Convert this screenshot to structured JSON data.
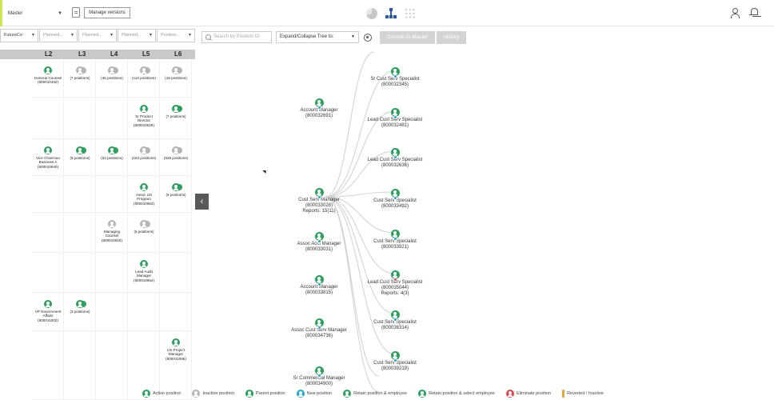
{
  "topbar": {
    "version_select": "Master",
    "manage_versions": "Manage versions"
  },
  "left_panel": {
    "filters": [
      "FutureCo",
      "Planned...",
      "Planned...",
      "Planned...",
      "Position..."
    ],
    "levels": [
      "L2",
      "L3",
      "L4",
      "L5",
      "L6"
    ],
    "cards": [
      {
        "col": 0,
        "row": 0,
        "type": "active",
        "lines": [
          "General Counsel",
          "(800010432)"
        ]
      },
      {
        "col": 1,
        "row": 0,
        "type": "inactive-multi",
        "lines": [
          "(7 positions)"
        ]
      },
      {
        "col": 2,
        "row": 0,
        "type": "inactive-multi",
        "lines": [
          "(45 positions)"
        ]
      },
      {
        "col": 3,
        "row": 0,
        "type": "inactive-multi",
        "lines": [
          "(112 positions)"
        ]
      },
      {
        "col": 4,
        "row": 0,
        "type": "inactive-multi",
        "lines": [
          "(18 positions)"
        ]
      },
      {
        "col": 3,
        "row": 1,
        "type": "active",
        "lines": [
          "Sr Product",
          "Director",
          "(800010626)"
        ]
      },
      {
        "col": 4,
        "row": 1,
        "type": "active-multi",
        "lines": [
          "(7 positions)"
        ]
      },
      {
        "col": 0,
        "row": 2,
        "type": "active",
        "lines": [
          "Vice Chairman",
          "Business A",
          "(800010640)"
        ]
      },
      {
        "col": 1,
        "row": 2,
        "type": "active-multi",
        "lines": [
          "(6 positions)"
        ]
      },
      {
        "col": 2,
        "row": 2,
        "type": "active-multi",
        "lines": [
          "(34 positions)"
        ]
      },
      {
        "col": 3,
        "row": 2,
        "type": "inactive-multi",
        "lines": [
          "(163 positions)"
        ]
      },
      {
        "col": 4,
        "row": 2,
        "type": "inactive-multi",
        "lines": [
          "(628 positions)"
        ]
      },
      {
        "col": 3,
        "row": 3,
        "type": "active",
        "lines": [
          "Assoc US",
          "Program",
          "(800010663)"
        ]
      },
      {
        "col": 4,
        "row": 3,
        "type": "active-multi",
        "lines": [
          "(6 positions)"
        ]
      },
      {
        "col": 2,
        "row": 4,
        "type": "inactive",
        "lines": [
          "Managing",
          "Counsel",
          "(800010915)"
        ]
      },
      {
        "col": 3,
        "row": 4,
        "type": "inactive-multi",
        "lines": [
          "(5 positions)"
        ]
      },
      {
        "col": 3,
        "row": 5,
        "type": "active",
        "lines": [
          "Lead Audit",
          "Manager",
          "(800010654)"
        ]
      },
      {
        "col": 0,
        "row": 6,
        "type": "active",
        "lines": [
          "VP Government",
          "Affairs",
          "(800011002)"
        ]
      },
      {
        "col": 1,
        "row": 6,
        "type": "active-multi",
        "lines": [
          "(3 positions)"
        ]
      },
      {
        "col": 4,
        "row": 7,
        "type": "active",
        "lines": [
          "US Project",
          "Manager",
          "(800011086)"
        ]
      }
    ]
  },
  "chart_toolbar": {
    "search_placeholder": "Search by Position ID",
    "expand_label": "Expand/Collapse Tree to:",
    "commit_label": "Commit to Master",
    "history_label": "History"
  },
  "tree": {
    "focus": {
      "title": "Cust Serv Manager",
      "id": "(800033028)",
      "reports": "Reports: 15(11)"
    },
    "left_nodes": [
      {
        "title": "Account Manager",
        "id": "(800032691)"
      },
      {
        "title": "Assoc Acct Manager",
        "id": "(800033031)"
      },
      {
        "title": "Account Manager",
        "id": "(800033815)"
      },
      {
        "title": "Assoc Cust Serv Manager",
        "id": "(800034736)"
      },
      {
        "title": "Sr Commercial Manager",
        "id": "(800034900)"
      }
    ],
    "right_nodes": [
      {
        "title": "Sr Cust Serv Specialist",
        "id": "(800032345)",
        "extra": "",
        "status": "new"
      },
      {
        "title": "Lead Cust Serv Specialist",
        "id": "(800032481)",
        "extra": "",
        "status": "new"
      },
      {
        "title": "Lead Cust Serv Specialist",
        "id": "(800032636)",
        "extra": "",
        "status": "new"
      },
      {
        "title": "Cust Serv Specialist",
        "id": "(800033492)",
        "extra": "",
        "status": "new"
      },
      {
        "title": "Cust Serv Specialist",
        "id": "(800033921)",
        "extra": "",
        "status": "new"
      },
      {
        "title": "Lead Cust Serv Specialist",
        "id": "(800035044)",
        "extra": "Reports: 4(3)",
        "status": "eliminate"
      },
      {
        "title": "Cust Serv Specialist",
        "id": "(800036314)",
        "extra": "",
        "status": "new"
      },
      {
        "title": "Cust Serv Specialist",
        "id": "(800039219)",
        "extra": "",
        "status": "new"
      }
    ]
  },
  "legend": [
    {
      "label": "Active position",
      "icon": "active"
    },
    {
      "label": "Inactive position",
      "icon": "inactive"
    },
    {
      "label": "Parent position",
      "icon": "parent"
    },
    {
      "label": "New position",
      "icon": "new"
    },
    {
      "label": "Retain position & employee",
      "icon": "retain"
    },
    {
      "label": "Retain position & select employee",
      "icon": "retain-select"
    },
    {
      "label": "Eliminate position",
      "icon": "eliminate"
    },
    {
      "label": "Reverted / Inactive",
      "icon": "reverted"
    }
  ],
  "colors": {
    "active": "#2e9f5e",
    "inactive": "#b5b5b5",
    "new": "#27a7c9",
    "eliminate": "#d64545",
    "reverted": "#e7a23a",
    "accent": "#c8e84a"
  }
}
